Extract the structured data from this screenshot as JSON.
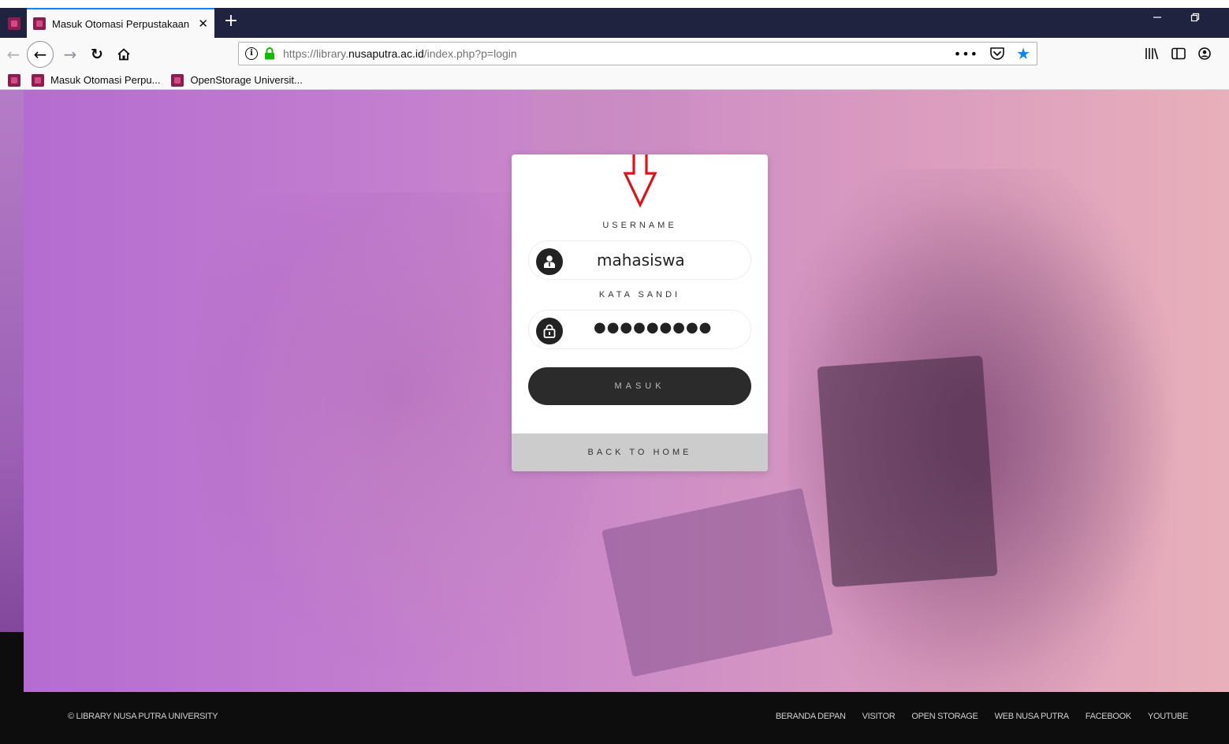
{
  "browser": {
    "tab_title": "Masuk Otomasi Perpustakaan |",
    "tab_close": "✕",
    "new_tab": "+",
    "url_scheme": "https://library.",
    "url_domain": "nusaputra.ac.id",
    "url_path": "/index.php?p=login",
    "url_more": "•••",
    "bookmarks": [
      {
        "label": "Masuk Otomasi Perpu..."
      },
      {
        "label": "OpenStorage Universit..."
      }
    ],
    "accent_color": "#0a84ff",
    "favicon_color": "#8b1e4f"
  },
  "login": {
    "username_label": "USERNAME",
    "username_value": "mahasiswa",
    "password_label": "KATA SANDI",
    "password_value": "●●●●●●●●●",
    "submit_label": "MASUK",
    "back_label": "BACK TO HOME",
    "annotation_color": "#e0101a"
  },
  "footer": {
    "copyright": "© LIBRARY NUSA PUTRA UNIVERSITY",
    "links": [
      {
        "label": "BERANDA DEPAN"
      },
      {
        "label": "VISITOR"
      },
      {
        "label": "OPEN STORAGE"
      },
      {
        "label": "WEB NUSA PUTRA"
      },
      {
        "label": "FACEBOOK"
      },
      {
        "label": "YOUTUBE"
      }
    ]
  }
}
